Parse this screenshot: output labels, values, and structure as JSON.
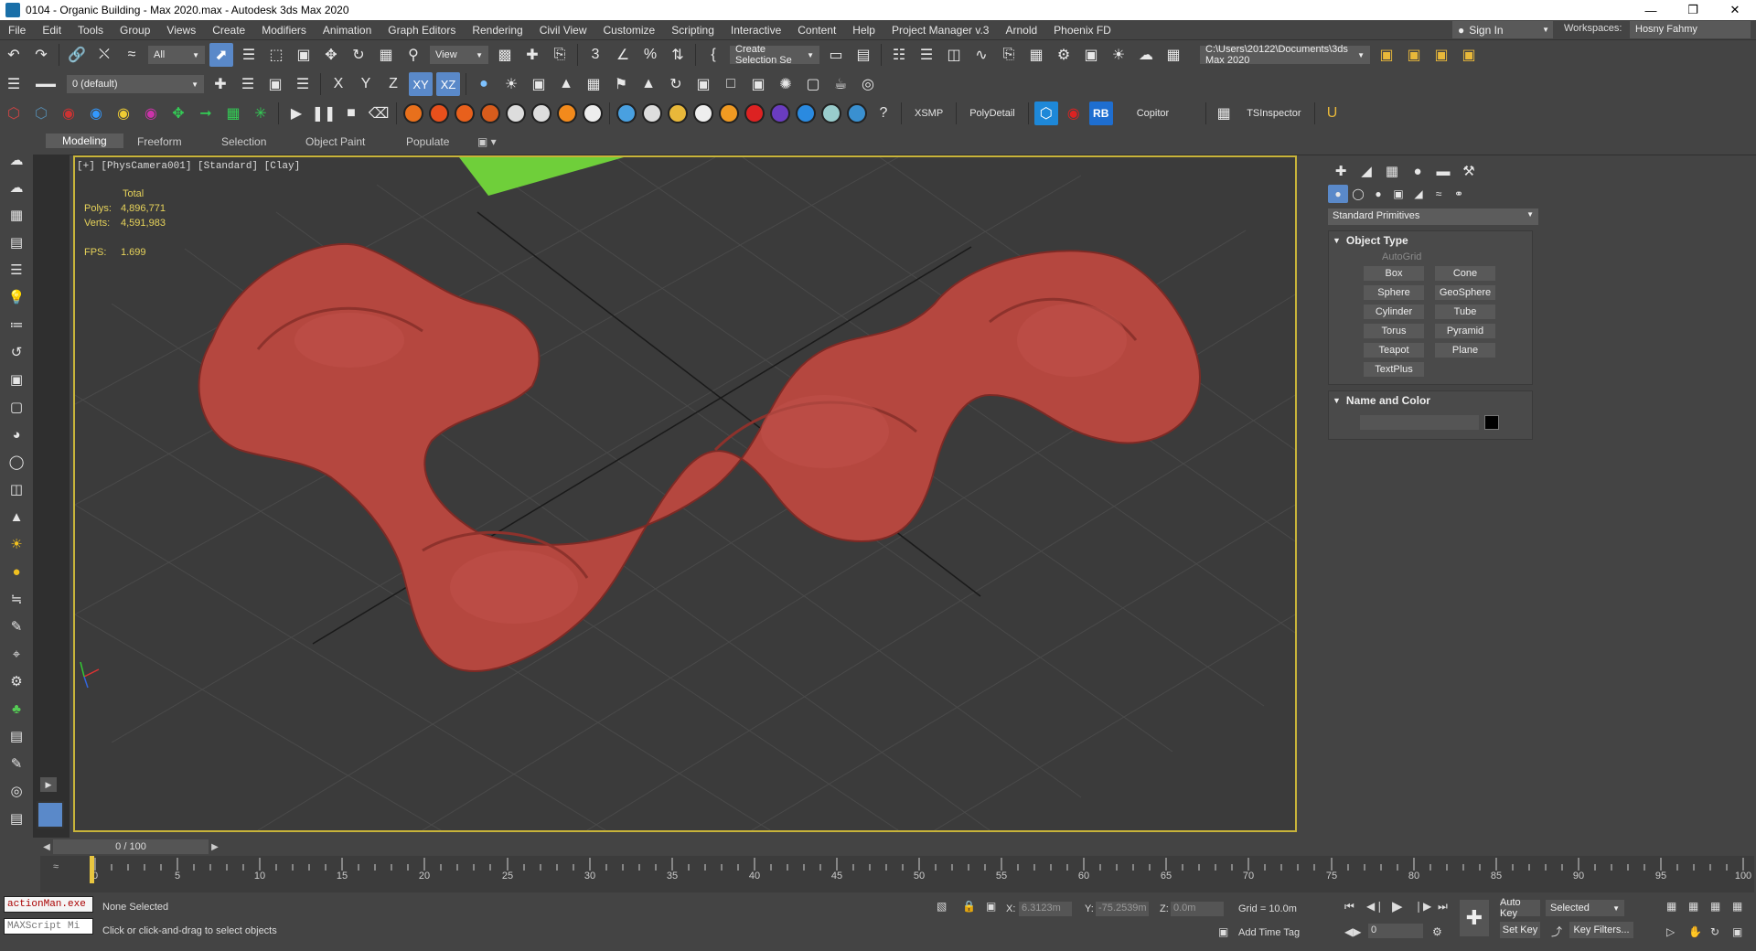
{
  "window": {
    "title": "0104 - Organic Building - Max 2020.max - Autodesk 3ds Max 2020",
    "controls": [
      "minimize",
      "maximize",
      "close"
    ]
  },
  "menu": {
    "items": [
      "File",
      "Edit",
      "Tools",
      "Group",
      "Views",
      "Create",
      "Modifiers",
      "Animation",
      "Graph Editors",
      "Rendering",
      "Civil View",
      "Customize",
      "Scripting",
      "Interactive",
      "Content",
      "Help",
      "Project Manager v.3",
      "Arnold",
      "Phoenix FD"
    ],
    "sign_in": "Sign In",
    "workspaces_label": "Workspaces:",
    "workspace_value": "Hosny Fahmy"
  },
  "toolbar1": {
    "filter": "All",
    "ref_coord": "View",
    "selection_set": "Create Selection Se",
    "project_path": "C:\\Users\\20122\\Documents\\3ds Max 2020"
  },
  "toolbar2": {
    "layer": "0 (default)",
    "axis_x": "X",
    "axis_y": "Y",
    "axis_z": "Z",
    "axis_xy": "XY",
    "axis_xz": "XZ"
  },
  "toolbar3": {
    "xsmp": "XSMP",
    "polydetail": "PolyDetail",
    "rb": "RB",
    "copitor": "Copitor",
    "tsinspector": "TSInspector"
  },
  "ribbon": {
    "tabs": [
      "Modeling",
      "Freeform",
      "Selection",
      "Object Paint",
      "Populate"
    ],
    "active": "Modeling"
  },
  "viewport": {
    "label": "[+] [PhysCamera001] [Standard] [Clay]",
    "stats": {
      "header": "Total",
      "polys_label": "Polys:",
      "polys": "4,896,771",
      "verts_label": "Verts:",
      "verts": "4,591,983",
      "fps_label": "FPS:",
      "fps": "1.699"
    }
  },
  "command_panel": {
    "category": "Standard Primitives",
    "object_type_title": "Object Type",
    "autogrid": "AutoGrid",
    "primitives": [
      "Box",
      "Cone",
      "Sphere",
      "GeoSphere",
      "Cylinder",
      "Tube",
      "Torus",
      "Pyramid",
      "Teapot",
      "Plane",
      "TextPlus"
    ],
    "name_color_title": "Name and Color",
    "swatch_color": "#000000"
  },
  "timeline": {
    "position": "0 / 100",
    "ticks": [
      "0",
      "5",
      "10",
      "15",
      "20",
      "25",
      "30",
      "35",
      "40",
      "45",
      "50",
      "55",
      "60",
      "65",
      "70",
      "75",
      "80",
      "85",
      "90",
      "95",
      "100"
    ]
  },
  "status": {
    "maxscript1": "actionMan.exe",
    "maxscript2": "MAXScript Mi",
    "selection": "None Selected",
    "prompt": "Click or click-and-drag to select objects",
    "x_label": "X:",
    "x_value": "6.3123m",
    "y_label": "Y:",
    "y_value": "-75.2539m",
    "z_label": "Z:",
    "z_value": "0.0m",
    "grid": "Grid = 10.0m",
    "add_time_tag": "Add Time Tag",
    "auto_key": "Auto Key",
    "selected": "Selected",
    "set_key": "Set Key",
    "key_filters": "Key Filters...",
    "frame": "0"
  },
  "colors": {
    "accent": "#5a89c9",
    "viewport_border": "#c8b43a",
    "model": "#b5473f",
    "stats_text": "#e7d35a"
  }
}
